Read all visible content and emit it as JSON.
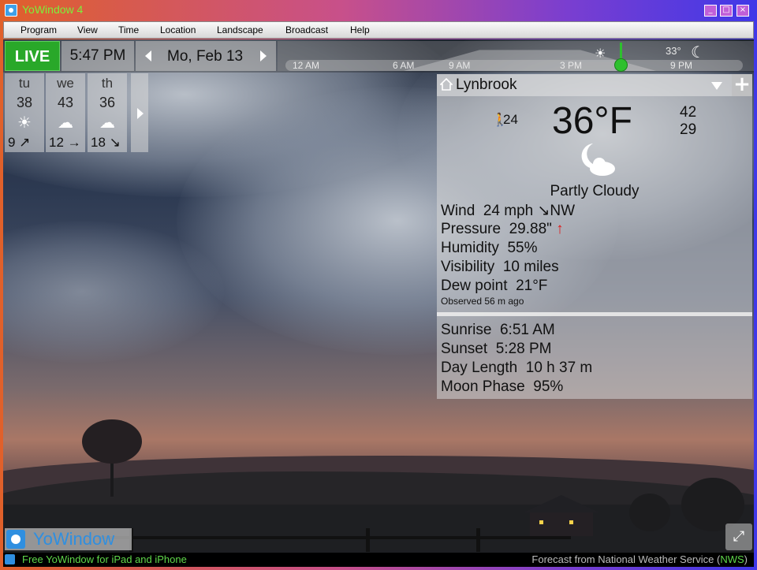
{
  "window": {
    "title": "YoWindow 4",
    "controls": [
      "_",
      "□",
      "×"
    ]
  },
  "menu": [
    "Program",
    "View",
    "Time",
    "Location",
    "Landscape",
    "Broadcast",
    "Help"
  ],
  "controlbar": {
    "live_label": "LIVE",
    "time": "5:47 PM",
    "date": "Mo, Feb 13"
  },
  "timeline": {
    "ticks": [
      "12 AM",
      "6 AM",
      "9 AM",
      "3 PM",
      "9 PM"
    ],
    "current_temp": "33°",
    "icons": [
      "partly-sunny-icon",
      "moon-icon"
    ]
  },
  "forecast": [
    {
      "day": "tu",
      "high": "38",
      "icon": "partly-sunny-icon",
      "wind": "9 ↗"
    },
    {
      "day": "we",
      "high": "43",
      "icon": "rain-cloud-icon",
      "wind": "12 →"
    },
    {
      "day": "th",
      "high": "36",
      "icon": "cloud-icon",
      "wind": "18 ↘"
    }
  ],
  "weather": {
    "city": "Lynbrook",
    "feels_like": "24",
    "temperature": "36°F",
    "high": "42",
    "low": "29",
    "condition": "Partly Cloudy",
    "wind_label": "Wind",
    "wind_value": "24 mph ↘NW",
    "pressure_label": "Pressure",
    "pressure_value": "29.88\"",
    "pressure_trend": "↑",
    "humidity_label": "Humidity",
    "humidity_value": "55%",
    "visibility_label": "Visibility",
    "visibility_value": "10 miles",
    "dewpoint_label": "Dew point",
    "dewpoint_value": "21°F",
    "observed": "Observed 56 m ago",
    "sunrise_label": "Sunrise",
    "sunrise_value": "6:51 AM",
    "sunset_label": "Sunset",
    "sunset_value": "5:28 PM",
    "daylength_label": "Day Length",
    "daylength_value": "10 h 37 m",
    "moonphase_label": "Moon Phase",
    "moonphase_value": "95%"
  },
  "footer": {
    "logo": "YoWindow",
    "promo": "Free YoWindow for iPad and iPhone",
    "credits_prefix": "Forecast from National Weather Service (",
    "credits_link": "NWS",
    "credits_suffix": ")"
  }
}
